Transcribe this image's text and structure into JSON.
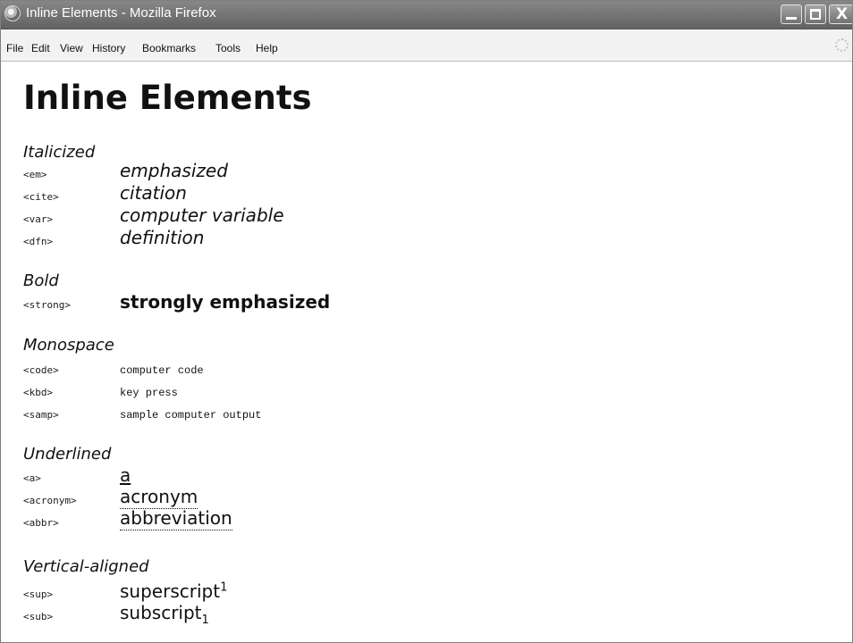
{
  "browser": {
    "window_title": "Inline Elements - Mozilla Firefox",
    "controls": {
      "minimize_icon": "minimize-icon",
      "maximize_icon": "maximize-icon",
      "close_icon": "close-icon",
      "close_glyph": "X"
    },
    "menu": [
      "File",
      "Edit",
      "View",
      "History",
      "Bookmarks",
      "Tools",
      "Help"
    ]
  },
  "page": {
    "title": "Inline Elements",
    "sections": {
      "italicized": {
        "heading": "Italicized",
        "rows": [
          {
            "tag": "<em>",
            "example": "emphasized"
          },
          {
            "tag": "<cite>",
            "example": "citation"
          },
          {
            "tag": "<var>",
            "example": "computer variable"
          },
          {
            "tag": "<dfn>",
            "example": "definition"
          }
        ]
      },
      "bold": {
        "heading": "Bold",
        "rows": [
          {
            "tag": "<strong>",
            "example": "strongly emphasized"
          }
        ]
      },
      "monospace": {
        "heading": "Monospace",
        "rows": [
          {
            "tag": "<code>",
            "example": "computer code"
          },
          {
            "tag": "<kbd>",
            "example": "key press"
          },
          {
            "tag": "<samp>",
            "example": "sample computer output"
          }
        ]
      },
      "underlined": {
        "heading": "Underlined",
        "rows": [
          {
            "tag": "<a>",
            "example": "a"
          },
          {
            "tag": "<acronym>",
            "example": "acronym"
          },
          {
            "tag": "<abbr>",
            "example": "abbreviation"
          }
        ]
      },
      "vertical_aligned": {
        "heading": "Vertical-aligned",
        "rows": [
          {
            "tag": "<sup>",
            "example": "superscript",
            "marker": "1"
          },
          {
            "tag": "<sub>",
            "example": "subscript",
            "marker": "1"
          }
        ]
      }
    }
  },
  "colors": {
    "titlebar": "#707070",
    "menubar": "#f2f2f2",
    "page_background": "#ffffff",
    "text": "#111111"
  }
}
